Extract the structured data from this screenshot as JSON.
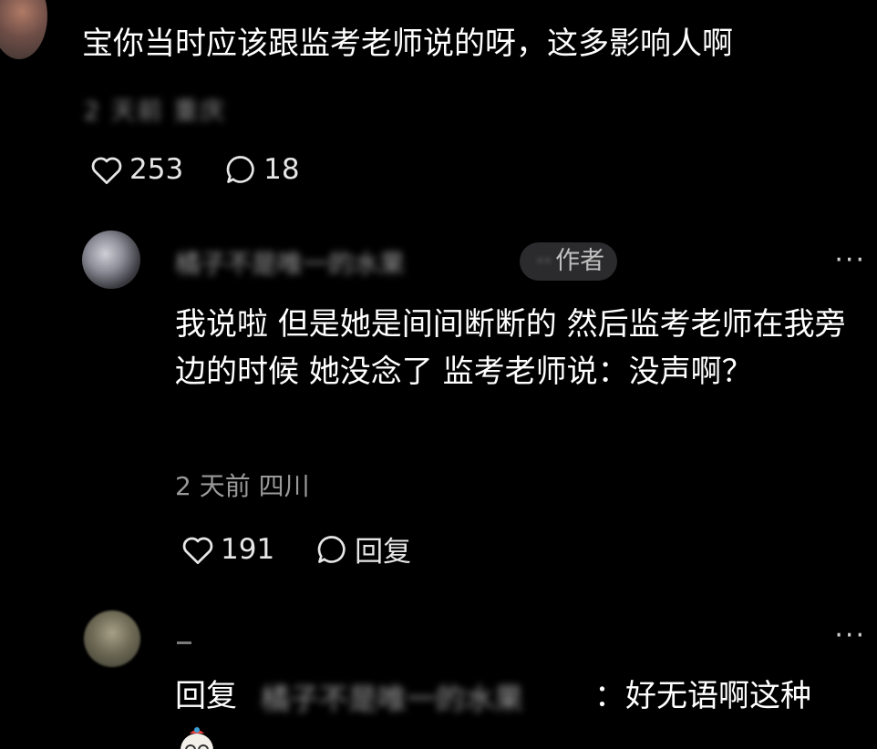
{
  "comment": {
    "text": "宝你当时应该跟监考老师说的呀，这多影响人啊",
    "meta_blurred": "2 天前 重庆",
    "likes": "253",
    "replies": "18"
  },
  "reply1": {
    "username_blurred": "橘子不是唯一的水果",
    "author_badge_label": "作者",
    "author_badge_smudge": "··",
    "text": "我说啦 但是她是间间断断的 然后监考老师在我旁边的时候 她没念了 监考老师说：没声啊？",
    "meta": "2 天前  四川",
    "likes": "191",
    "reply_label": "回复",
    "more": "···"
  },
  "reply2": {
    "username": "-",
    "reply_prefix": "回复",
    "reply_target_blurred": "橘子不是唯一的水果",
    "text": "：好无语啊这种",
    "more": "···"
  },
  "colors": {
    "background": "#000000",
    "text": "#ffffff",
    "muted": "#9a9a9a",
    "badge_bg": "#2b2b2d"
  }
}
